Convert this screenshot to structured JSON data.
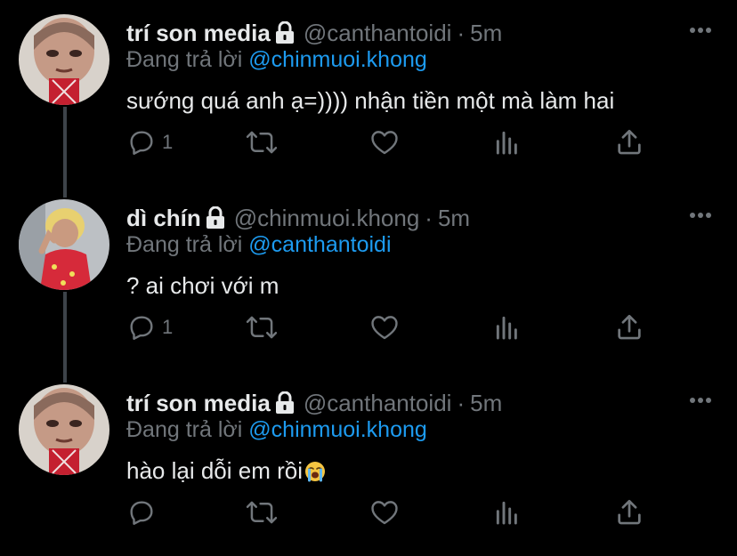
{
  "tweets": [
    {
      "name": "trí son media",
      "handle": "@canthantoidi",
      "separator": "·",
      "time": "5m",
      "reply_prefix": "Đang trả lời",
      "reply_to": "@chinmuoi.khong",
      "text": "sướng quá anh ạ=)))) nhận tiền một mà làm hai",
      "reply_count": "1",
      "has_emoji": false
    },
    {
      "name": "dì chín",
      "handle": "@chinmuoi.khong",
      "separator": "·",
      "time": "5m",
      "reply_prefix": "Đang trả lời",
      "reply_to": "@canthantoidi",
      "text": "? ai chơi với m",
      "reply_count": "1",
      "has_emoji": false
    },
    {
      "name": "trí son media",
      "handle": "@canthantoidi",
      "separator": "·",
      "time": "5m",
      "reply_prefix": "Đang trả lời",
      "reply_to": "@chinmuoi.khong",
      "text": "hào lại dỗi em rồi",
      "reply_count": "",
      "has_emoji": true,
      "emoji": "loudly-crying-face"
    }
  ],
  "colors": {
    "background": "#000000",
    "text": "#e7e9ea",
    "secondary": "#71767b",
    "link": "#1d9bf0",
    "thread_line": "#3d4349"
  },
  "icons": [
    "reply-icon",
    "retweet-icon",
    "like-icon",
    "analytics-icon",
    "share-icon",
    "lock-icon",
    "more-icon"
  ]
}
